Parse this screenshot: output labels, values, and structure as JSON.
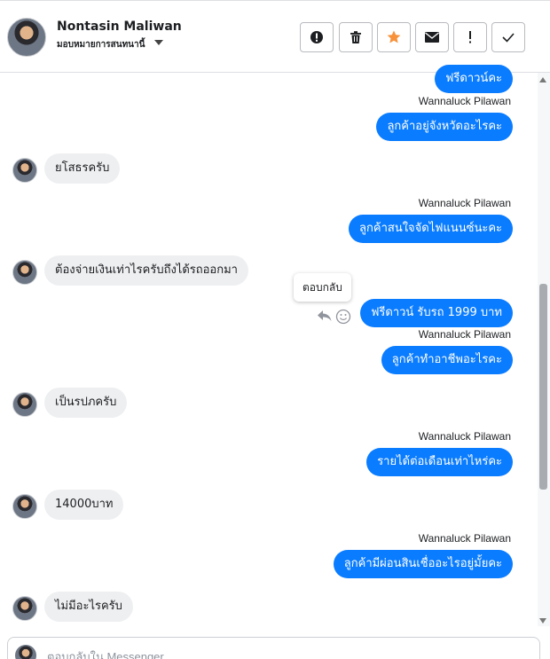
{
  "header": {
    "contact_name": "Nontasin Maliwan",
    "assigned_label": "มอบหมายการสนทนานี้",
    "avatar_icon": "user-avatar",
    "actions": [
      {
        "name": "mark-spam",
        "icon": "exclamation-circle-icon"
      },
      {
        "name": "delete",
        "icon": "trash-icon"
      },
      {
        "name": "star",
        "icon": "star-icon",
        "color": "#f7923b"
      },
      {
        "name": "mark-unread",
        "icon": "envelope-icon"
      },
      {
        "name": "follow-up",
        "icon": "exclamation-icon"
      },
      {
        "name": "mark-done",
        "icon": "check-icon"
      }
    ]
  },
  "messages": {
    "m1_text": "ฟรีดาวน์คะ",
    "m2_sender": "Wannaluck Pilawan",
    "m2_text": "ลูกค้าอยู่จังหวัดอะไรคะ",
    "m3_text": "ยโสธรครับ",
    "m4_sender": "Wannaluck Pilawan",
    "m4_text": "ลูกค้าสนใจจัดไฟแนนซ์นะคะ",
    "m5_text": "ต้องจ่ายเงินเท่าไรครับถึงได้รถออกมา",
    "m6_text": "ฟรีดาวน์  รับรถ 1999 บาท",
    "m7_sender": "Wannaluck Pilawan",
    "m7_text": "ลูกค้าทำอาชีพอะไรคะ",
    "m8_text": "เป็นรปภครับ",
    "m9_sender": "Wannaluck Pilawan",
    "m9_text": "รายได้ต่อเดือนเท่าไหร่คะ",
    "m10_text": "14000บาท",
    "m11_sender": "Wannaluck Pilawan",
    "m11_text": "ลูกค้ามีผ่อนสินเชื่ออะไรอยู่มั้ยคะ",
    "m12_text": "ไม่มีอะไรครับ"
  },
  "tooltip": {
    "reply_label": "ตอบกลับ"
  },
  "composer": {
    "placeholder": "ตอบกลับใน Messenger"
  },
  "colors": {
    "outgoing_bubble": "#0a7cff",
    "incoming_bubble": "#eeeff1",
    "star_accent": "#f7923b"
  }
}
